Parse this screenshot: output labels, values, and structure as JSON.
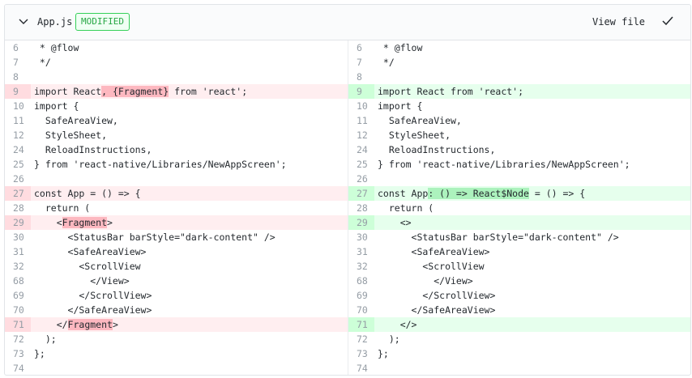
{
  "header": {
    "filename": "App.js",
    "status_badge": "MODIFIED",
    "view_file_label": "View file",
    "collapse_icon": "chevron-down-icon",
    "viewed_icon": "check-icon"
  },
  "colors": {
    "deleted_line_bg": "#ffeef0",
    "deleted_highlight": "#fdb8c0",
    "added_line_bg": "#e6ffed",
    "added_highlight": "#acf2bd",
    "badge_green": "#28a745"
  },
  "diff": {
    "left": [
      {
        "num": "6",
        "type": "ctx",
        "segments": [
          {
            "t": " * @flow"
          }
        ]
      },
      {
        "num": "7",
        "type": "ctx",
        "segments": [
          {
            "t": " */"
          }
        ]
      },
      {
        "num": "8",
        "type": "ctx",
        "segments": [
          {
            "t": ""
          }
        ]
      },
      {
        "num": "9",
        "type": "del",
        "segments": [
          {
            "t": "import React"
          },
          {
            "t": ", {Fragment}",
            "hl": true
          },
          {
            "t": " from 'react';"
          }
        ]
      },
      {
        "num": "10",
        "type": "ctx",
        "segments": [
          {
            "t": "import {"
          }
        ]
      },
      {
        "num": "11",
        "type": "ctx",
        "segments": [
          {
            "t": "  SafeAreaView,"
          }
        ]
      },
      {
        "num": "12",
        "type": "ctx",
        "segments": [
          {
            "t": "  StyleSheet,"
          }
        ]
      },
      {
        "num": "24",
        "type": "ctx",
        "segments": [
          {
            "t": "  ReloadInstructions,"
          }
        ]
      },
      {
        "num": "25",
        "type": "ctx",
        "segments": [
          {
            "t": "} from 'react-native/Libraries/NewAppScreen';"
          }
        ]
      },
      {
        "num": "26",
        "type": "ctx",
        "segments": [
          {
            "t": ""
          }
        ]
      },
      {
        "num": "27",
        "type": "del",
        "segments": [
          {
            "t": "const App = () => {"
          }
        ]
      },
      {
        "num": "28",
        "type": "ctx",
        "segments": [
          {
            "t": "  return ("
          }
        ]
      },
      {
        "num": "29",
        "type": "del",
        "segments": [
          {
            "t": "    <"
          },
          {
            "t": "Fragment",
            "hl": true
          },
          {
            "t": ">"
          }
        ]
      },
      {
        "num": "30",
        "type": "ctx",
        "segments": [
          {
            "t": "      <StatusBar barStyle=\"dark-content\" />"
          }
        ]
      },
      {
        "num": "31",
        "type": "ctx",
        "segments": [
          {
            "t": "      <SafeAreaView>"
          }
        ]
      },
      {
        "num": "32",
        "type": "ctx",
        "segments": [
          {
            "t": "        <ScrollView"
          }
        ]
      },
      {
        "num": "68",
        "type": "ctx",
        "segments": [
          {
            "t": "          </View>"
          }
        ]
      },
      {
        "num": "69",
        "type": "ctx",
        "segments": [
          {
            "t": "        </ScrollView>"
          }
        ]
      },
      {
        "num": "70",
        "type": "ctx",
        "segments": [
          {
            "t": "      </SafeAreaView>"
          }
        ]
      },
      {
        "num": "71",
        "type": "del",
        "segments": [
          {
            "t": "    </"
          },
          {
            "t": "Fragment",
            "hl": true
          },
          {
            "t": ">"
          }
        ]
      },
      {
        "num": "72",
        "type": "ctx",
        "segments": [
          {
            "t": "  );"
          }
        ]
      },
      {
        "num": "73",
        "type": "ctx",
        "segments": [
          {
            "t": "};"
          }
        ]
      },
      {
        "num": "74",
        "type": "ctx",
        "segments": [
          {
            "t": ""
          }
        ]
      }
    ],
    "right": [
      {
        "num": "6",
        "type": "ctx",
        "segments": [
          {
            "t": " * @flow"
          }
        ]
      },
      {
        "num": "7",
        "type": "ctx",
        "segments": [
          {
            "t": " */"
          }
        ]
      },
      {
        "num": "8",
        "type": "ctx",
        "segments": [
          {
            "t": ""
          }
        ]
      },
      {
        "num": "9",
        "type": "add",
        "segments": [
          {
            "t": "import React from 'react';"
          }
        ]
      },
      {
        "num": "10",
        "type": "ctx",
        "segments": [
          {
            "t": "import {"
          }
        ]
      },
      {
        "num": "11",
        "type": "ctx",
        "segments": [
          {
            "t": "  SafeAreaView,"
          }
        ]
      },
      {
        "num": "12",
        "type": "ctx",
        "segments": [
          {
            "t": "  StyleSheet,"
          }
        ]
      },
      {
        "num": "24",
        "type": "ctx",
        "segments": [
          {
            "t": "  ReloadInstructions,"
          }
        ]
      },
      {
        "num": "25",
        "type": "ctx",
        "segments": [
          {
            "t": "} from 'react-native/Libraries/NewAppScreen';"
          }
        ]
      },
      {
        "num": "26",
        "type": "ctx",
        "segments": [
          {
            "t": ""
          }
        ]
      },
      {
        "num": "27",
        "type": "add",
        "segments": [
          {
            "t": "const App"
          },
          {
            "t": ": () => React$Node",
            "hl": true
          },
          {
            "t": " = () => {"
          }
        ]
      },
      {
        "num": "28",
        "type": "ctx",
        "segments": [
          {
            "t": "  return ("
          }
        ]
      },
      {
        "num": "29",
        "type": "add",
        "segments": [
          {
            "t": "    <>"
          }
        ]
      },
      {
        "num": "30",
        "type": "ctx",
        "segments": [
          {
            "t": "      <StatusBar barStyle=\"dark-content\" />"
          }
        ]
      },
      {
        "num": "31",
        "type": "ctx",
        "segments": [
          {
            "t": "      <SafeAreaView>"
          }
        ]
      },
      {
        "num": "32",
        "type": "ctx",
        "segments": [
          {
            "t": "        <ScrollView"
          }
        ]
      },
      {
        "num": "68",
        "type": "ctx",
        "segments": [
          {
            "t": "          </View>"
          }
        ]
      },
      {
        "num": "69",
        "type": "ctx",
        "segments": [
          {
            "t": "        </ScrollView>"
          }
        ]
      },
      {
        "num": "70",
        "type": "ctx",
        "segments": [
          {
            "t": "      </SafeAreaView>"
          }
        ]
      },
      {
        "num": "71",
        "type": "add",
        "segments": [
          {
            "t": "    </>"
          }
        ]
      },
      {
        "num": "72",
        "type": "ctx",
        "segments": [
          {
            "t": "  );"
          }
        ]
      },
      {
        "num": "73",
        "type": "ctx",
        "segments": [
          {
            "t": "};"
          }
        ]
      },
      {
        "num": "74",
        "type": "ctx",
        "segments": [
          {
            "t": ""
          }
        ]
      }
    ]
  }
}
